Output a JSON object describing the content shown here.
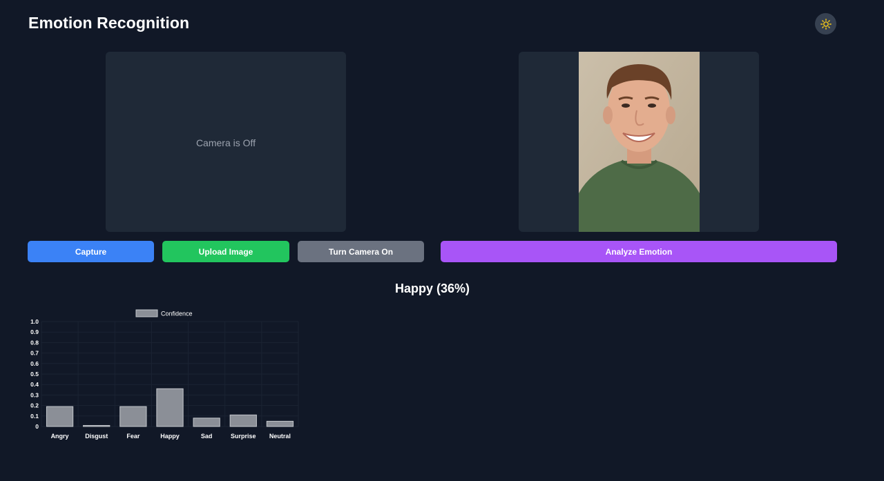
{
  "app": {
    "title": "Emotion Recognition"
  },
  "camera": {
    "status_text": "Camera is Off"
  },
  "buttons": {
    "capture": "Capture",
    "upload": "Upload Image",
    "camera_toggle": "Turn Camera On",
    "analyze": "Analyze Emotion"
  },
  "result": {
    "label": "Happy (36%)"
  },
  "icons": {
    "theme_toggle": "sun-icon"
  },
  "colors": {
    "background": "#111827",
    "panel": "#1f2937",
    "capture": "#3b82f6",
    "upload": "#22c55e",
    "camera_toggle": "#6b7280",
    "analyze": "#a855f7",
    "bar_fill": "#9ca3af"
  },
  "chart_data": {
    "type": "bar",
    "categories": [
      "Angry",
      "Disgust",
      "Fear",
      "Happy",
      "Sad",
      "Surprise",
      "Neutral"
    ],
    "series": [
      {
        "name": "Confidence",
        "values": [
          0.19,
          0.01,
          0.19,
          0.36,
          0.08,
          0.11,
          0.05
        ]
      }
    ],
    "ylim": [
      0,
      1.0
    ],
    "yticks": [
      "0",
      "0.1",
      "0.2",
      "0.3",
      "0.4",
      "0.5",
      "0.6",
      "0.7",
      "0.8",
      "0.9",
      "1.0"
    ],
    "title": "",
    "xlabel": "",
    "ylabel": "",
    "legend": "top-center",
    "grid": true
  }
}
